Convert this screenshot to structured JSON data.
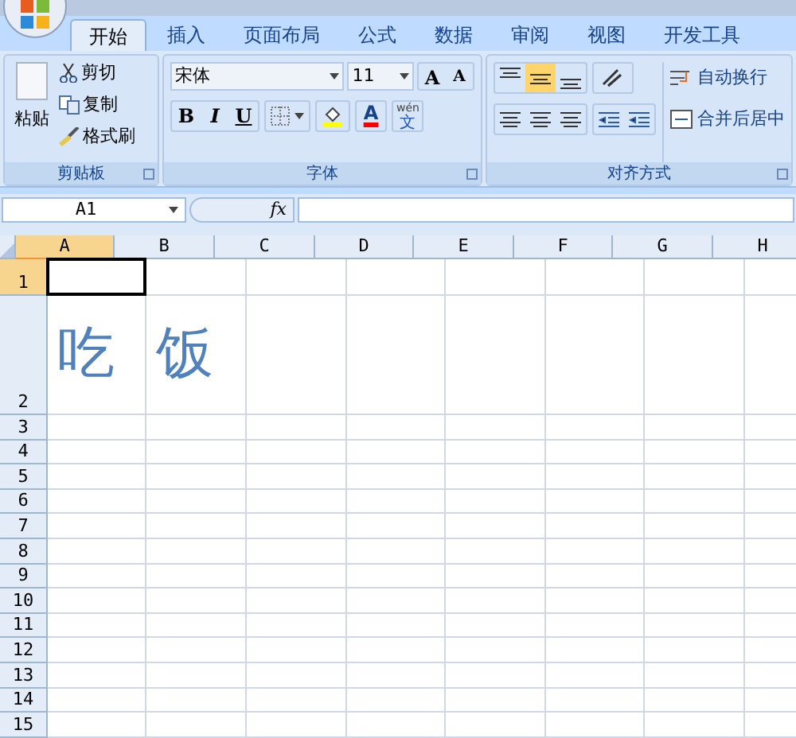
{
  "tabs": [
    {
      "label": "开始",
      "selected": true
    },
    {
      "label": "插入",
      "selected": false
    },
    {
      "label": "页面布局",
      "selected": false
    },
    {
      "label": "公式",
      "selected": false
    },
    {
      "label": "数据",
      "selected": false
    },
    {
      "label": "审阅",
      "selected": false
    },
    {
      "label": "视图",
      "selected": false
    },
    {
      "label": "开发工具",
      "selected": false
    }
  ],
  "clipboard": {
    "paste": "粘贴",
    "cut": "剪切",
    "copy": "复制",
    "format_painter": "格式刷",
    "group_label": "剪贴板"
  },
  "font": {
    "font_name": "宋体",
    "font_size": "11",
    "grow": "A",
    "shrink": "A",
    "bold": "B",
    "italic": "I",
    "underline": "U",
    "font_color": "A",
    "phonetic_top": "wén",
    "phonetic_bottom": "文",
    "group_label": "字体"
  },
  "alignment": {
    "vertical": [
      {
        "kind": "top",
        "selected": false
      },
      {
        "kind": "middle",
        "selected": true
      },
      {
        "kind": "bottom",
        "selected": false
      }
    ],
    "wrap_text": "自动换行",
    "merge_center": "合并后居中",
    "group_label": "对齐方式"
  },
  "formula_bar": {
    "name_box": "A1",
    "fx": "fx"
  },
  "columns": [
    {
      "label": "A",
      "selected": true
    },
    {
      "label": "B",
      "selected": false
    },
    {
      "label": "C",
      "selected": false
    },
    {
      "label": "D",
      "selected": false
    },
    {
      "label": "E",
      "selected": false
    },
    {
      "label": "F",
      "selected": false
    },
    {
      "label": "G",
      "selected": false
    },
    {
      "label": "H",
      "selected": false
    }
  ],
  "rows": [
    {
      "label": "1",
      "selected": true,
      "kind": "normal"
    },
    {
      "label": "2",
      "selected": false,
      "kind": "tall",
      "cells": [
        "吃",
        "饭"
      ]
    },
    {
      "label": "3",
      "selected": false,
      "kind": "normal"
    },
    {
      "label": "4",
      "selected": false,
      "kind": "normal"
    },
    {
      "label": "5",
      "selected": false,
      "kind": "normal"
    },
    {
      "label": "6",
      "selected": false,
      "kind": "normal"
    },
    {
      "label": "7",
      "selected": false,
      "kind": "normal"
    },
    {
      "label": "8",
      "selected": false,
      "kind": "normal"
    },
    {
      "label": "9",
      "selected": false,
      "kind": "normal"
    },
    {
      "label": "10",
      "selected": false,
      "kind": "normal"
    },
    {
      "label": "11",
      "selected": false,
      "kind": "normal"
    },
    {
      "label": "12",
      "selected": false,
      "kind": "normal"
    },
    {
      "label": "13",
      "selected": false,
      "kind": "normal"
    },
    {
      "label": "14",
      "selected": false,
      "kind": "normal"
    },
    {
      "label": "15",
      "selected": false,
      "kind": "normal"
    }
  ]
}
